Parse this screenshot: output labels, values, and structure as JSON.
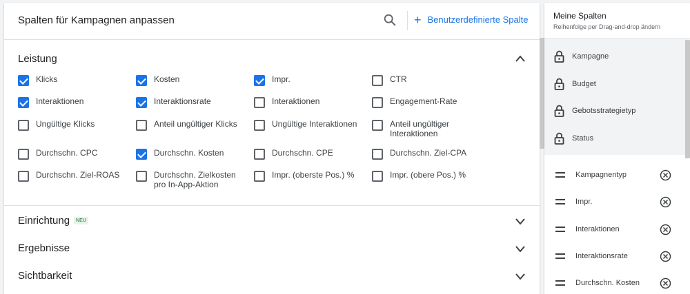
{
  "header": {
    "title": "Spalten für Kampagnen anpassen",
    "custom_column_label": "Benutzerdefinierte Spalte"
  },
  "sections": {
    "leistung": "Leistung",
    "einrichtung": "Einrichtung",
    "einrichtung_badge": "NEU",
    "ergebnisse": "Ergebnisse",
    "sichtbarkeit": "Sichtbarkeit"
  },
  "metrics": [
    [
      {
        "label": "Klicks",
        "checked": true
      },
      {
        "label": "Kosten",
        "checked": true
      },
      {
        "label": "Impr.",
        "checked": true
      },
      {
        "label": "CTR",
        "checked": false
      }
    ],
    [
      {
        "label": "Interaktionen",
        "checked": true
      },
      {
        "label": "Interaktionsrate",
        "checked": true
      },
      {
        "label": "Interaktionen",
        "checked": false
      },
      {
        "label": "Engagement-Rate",
        "checked": false
      }
    ],
    [
      {
        "label": "Ungültige Klicks",
        "checked": false
      },
      {
        "label": "Anteil ungültiger Klicks",
        "checked": false
      },
      {
        "label": "Ungültige Interaktionen",
        "checked": false
      },
      {
        "label": "Anteil ungültiger Interaktionen",
        "checked": false
      }
    ],
    [
      {
        "label": "Durchschn. CPC",
        "checked": false
      },
      {
        "label": "Durchschn. Kosten",
        "checked": true
      },
      {
        "label": "Durchschn. CPE",
        "checked": false
      },
      {
        "label": "Durchschn. Ziel-CPA",
        "checked": false
      }
    ],
    [
      {
        "label": "Durchschn. Ziel-ROAS",
        "checked": false
      },
      {
        "label": "Durchschn. Zielkosten pro In-App-Aktion",
        "checked": false
      },
      {
        "label": "Impr. (oberste Pos.) %",
        "checked": false
      },
      {
        "label": "Impr. (obere Pos.) %",
        "checked": false
      }
    ]
  ],
  "my_columns": {
    "title": "Meine Spalten",
    "subtitle": "Reihenfolge per Drag-and-drop ändern",
    "locked": [
      "Kampagne",
      "Budget",
      "Gebotsstrategietyp",
      "Status"
    ],
    "movable": [
      "Kampagnentyp",
      "Impr.",
      "Interaktionen",
      "Interaktionsrate",
      "Durchschn. Kosten"
    ]
  },
  "colors": {
    "accent": "#1a73e8",
    "checkbox_border": "#5f6368",
    "badge_bg": "#e6f4ea",
    "badge_text": "#137333"
  },
  "icons": {
    "search": "search-icon",
    "add": "plus-icon",
    "collapse": "chevron-up-icon",
    "expand": "chevron-down-icon",
    "lock": "lock-icon",
    "drag": "drag-handle-icon",
    "remove": "remove-circle-icon"
  }
}
